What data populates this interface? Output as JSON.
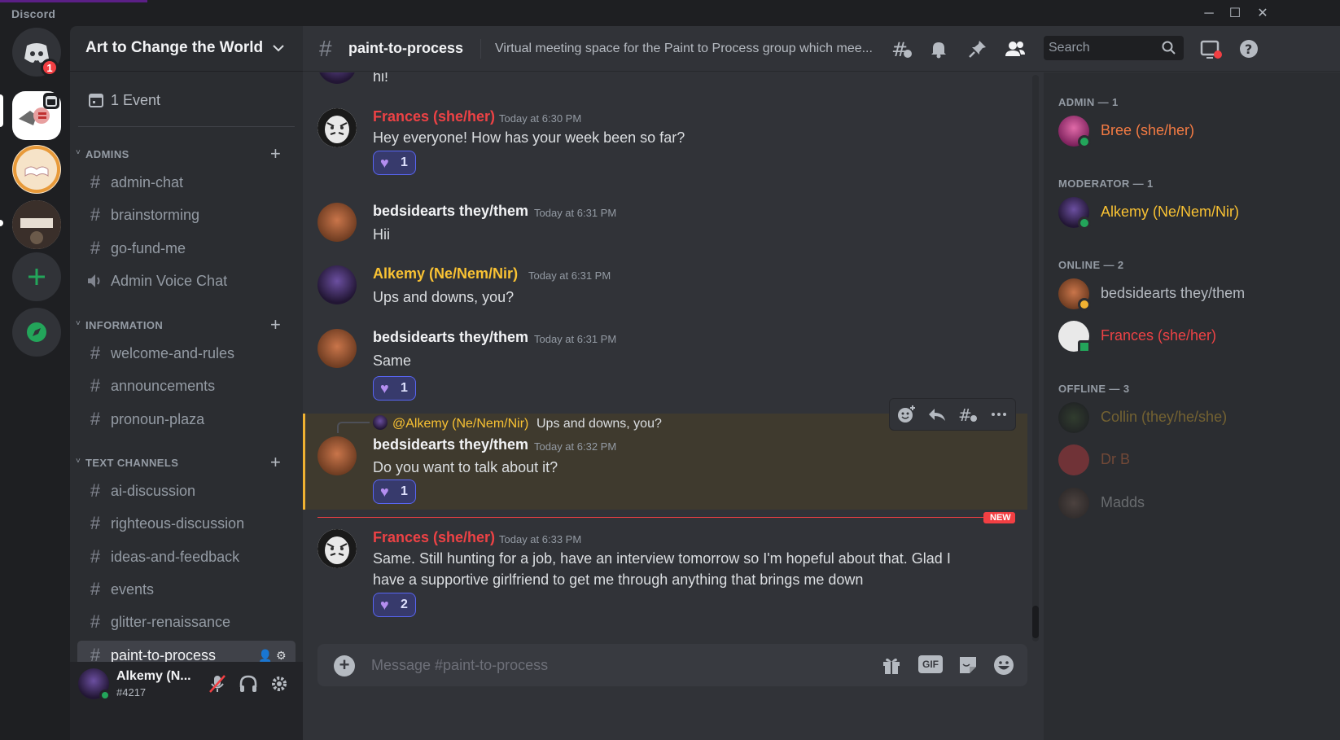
{
  "app": {
    "title": "Discord"
  },
  "rail": {
    "home_badge": "1"
  },
  "guild": {
    "name": "Art to Change the World",
    "event_label": "1 Event"
  },
  "categories": {
    "admins": "ADMINS",
    "information": "INFORMATION",
    "text": "TEXT CHANNELS"
  },
  "channels": {
    "admins": [
      "admin-chat",
      "brainstorming",
      "go-fund-me",
      "Admin Voice Chat"
    ],
    "information": [
      "welcome-and-rules",
      "announcements",
      "pronoun-plaza"
    ],
    "text": [
      "ai-discussion",
      "righteous-discussion",
      "ideas-and-feedback",
      "events",
      "glitter-renaissance",
      "paint-to-process"
    ]
  },
  "user": {
    "name": "Alkemy (N...",
    "tag": "#4217"
  },
  "header": {
    "channel": "paint-to-process",
    "topic": "Virtual meeting space for the Paint to Process group which mee...",
    "search_placeholder": "Search"
  },
  "messages": [
    {
      "partial_body": "hi!"
    },
    {
      "author": "Frances (she/her)",
      "time": "Today at 6:30 PM",
      "body": "Hey everyone! How has your week been so far?",
      "reaction": "1"
    },
    {
      "author": "bedsidearts they/them",
      "time": "Today at 6:31 PM",
      "body": "Hii"
    },
    {
      "author": "Alkemy (Ne/Nem/Nir)",
      "time": "Today at 6:31 PM",
      "body": "Ups and downs, you?"
    },
    {
      "author": "bedsidearts they/them",
      "time": "Today at 6:31 PM",
      "body": "Same",
      "reaction": "1"
    },
    {
      "reply_mention": "@Alkemy (Ne/Nem/Nir)",
      "reply_text": "Ups and downs, you?",
      "author": "bedsidearts they/them",
      "time": "Today at 6:32 PM",
      "body": "Do you want to talk about it?",
      "reaction": "1"
    },
    {
      "author": "Frances (she/her)",
      "time": "Today at 6:33 PM",
      "body": "Same. Still hunting for a job, have an interview tomorrow so I'm hopeful about that. Glad I have a supportive girlfriend to get me through anything that brings me down",
      "reaction": "2"
    }
  ],
  "new_label": "NEW",
  "composer": {
    "placeholder": "Message #paint-to-process",
    "gif_label": "GIF"
  },
  "members": {
    "groups": [
      "ADMIN — 1",
      "MODERATOR — 1",
      "ONLINE — 2",
      "OFFLINE — 3"
    ],
    "admin": "Bree (she/her)",
    "moderator": "Alkemy (Ne/Nem/Nir)",
    "online": [
      "bedsidearts they/them",
      "Frances (she/her)"
    ],
    "offline": [
      "Collin (they/he/she)",
      "Dr B",
      "Madds"
    ]
  },
  "colors": {
    "accent": "#5865f2",
    "admin_role": "#f47b43",
    "mod_role": "#f9c233",
    "red_role": "#ed4245",
    "online": "#23a55a",
    "idle": "#f0b232"
  }
}
